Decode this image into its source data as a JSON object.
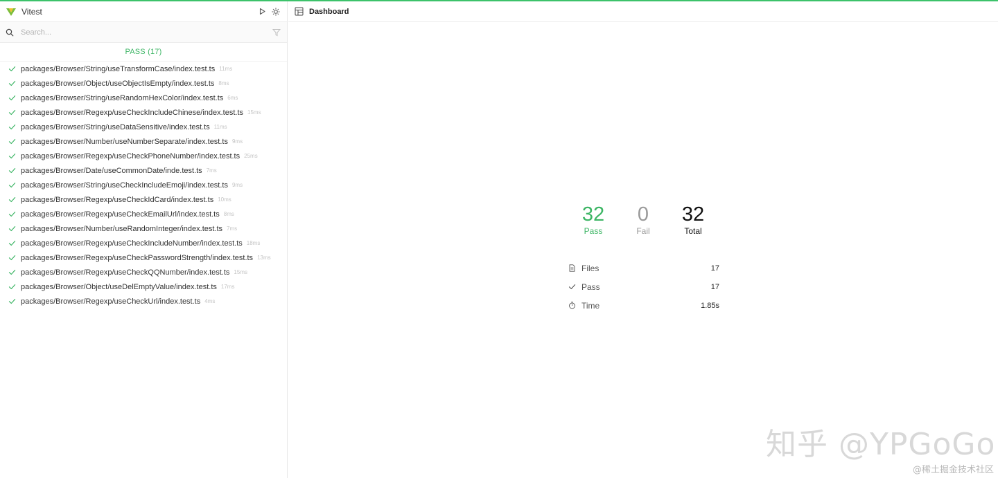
{
  "app": {
    "title": "Vitest"
  },
  "search": {
    "placeholder": "Search..."
  },
  "colors": {
    "accent": "#3cb564",
    "fail": "#9a9a9a"
  },
  "icons": {
    "run": "play-icon",
    "theme": "sun-icon",
    "filter": "filter-icon",
    "search": "search-icon"
  },
  "sidebar": {
    "pass_header": "PASS (17)",
    "files": [
      {
        "path": "packages/Browser/String/useTransformCase/index.test.ts",
        "duration": "11ms"
      },
      {
        "path": "packages/Browser/Object/useObjectIsEmpty/index.test.ts",
        "duration": "8ms"
      },
      {
        "path": "packages/Browser/String/useRandomHexColor/index.test.ts",
        "duration": "6ms"
      },
      {
        "path": "packages/Browser/Regexp/useCheckIncludeChinese/index.test.ts",
        "duration": "15ms"
      },
      {
        "path": "packages/Browser/String/useDataSensitive/index.test.ts",
        "duration": "11ms"
      },
      {
        "path": "packages/Browser/Number/useNumberSeparate/index.test.ts",
        "duration": "9ms"
      },
      {
        "path": "packages/Browser/Regexp/useCheckPhoneNumber/index.test.ts",
        "duration": "25ms"
      },
      {
        "path": "packages/Browser/Date/useCommonDate/inde.test.ts",
        "duration": "7ms"
      },
      {
        "path": "packages/Browser/String/useCheckIncludeEmoji/index.test.ts",
        "duration": "9ms"
      },
      {
        "path": "packages/Browser/Regexp/useCheckIdCard/index.test.ts",
        "duration": "10ms"
      },
      {
        "path": "packages/Browser/Regexp/useCheckEmailUrl/index.test.ts",
        "duration": "8ms"
      },
      {
        "path": "packages/Browser/Number/useRandomInteger/index.test.ts",
        "duration": "7ms"
      },
      {
        "path": "packages/Browser/Regexp/useCheckIncludeNumber/index.test.ts",
        "duration": "18ms"
      },
      {
        "path": "packages/Browser/Regexp/useCheckPasswordStrength/index.test.ts",
        "duration": "13ms"
      },
      {
        "path": "packages/Browser/Regexp/useCheckQQNumber/index.test.ts",
        "duration": "15ms"
      },
      {
        "path": "packages/Browser/Object/useDelEmptyValue/index.test.ts",
        "duration": "17ms"
      },
      {
        "path": "packages/Browser/Regexp/useCheckUrl/index.test.ts",
        "duration": "4ms"
      }
    ]
  },
  "main": {
    "title": "Dashboard",
    "stats": {
      "pass": {
        "value": "32",
        "label": "Pass"
      },
      "fail": {
        "value": "0",
        "label": "Fail"
      },
      "total": {
        "value": "32",
        "label": "Total"
      }
    },
    "summary": {
      "files": {
        "label": "Files",
        "value": "17"
      },
      "pass": {
        "label": "Pass",
        "value": "17"
      },
      "time": {
        "label": "Time",
        "value": "1.85s"
      }
    }
  },
  "watermark": {
    "text": "知乎 @YPGoGo"
  },
  "footer_note": "@稀土掘金技术社区"
}
